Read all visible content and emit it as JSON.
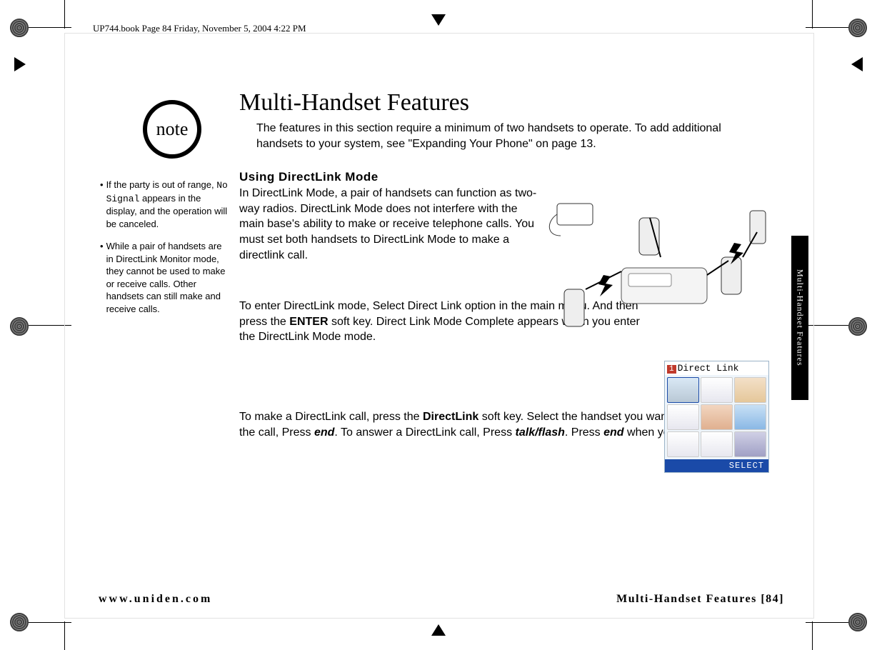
{
  "header": {
    "running_head": "UP744.book  Page 84  Friday, November 5, 2004  4:22 PM"
  },
  "side_tab": "Multi-Handset Features",
  "note": {
    "badge": "note",
    "items": [
      {
        "pre": "If the party is out of range, ",
        "mono": "No Signal",
        "post": " appears in the display, and the operation will be canceled."
      },
      {
        "text": "While a pair of handsets are in DirectLink Monitor mode, they cannot be used to make or receive calls. Other handsets can still make and receive calls."
      }
    ]
  },
  "main": {
    "title": "Multi-Handset Features",
    "intro": "The features in this section require a minimum of two handsets to operate. To add additional handsets to your system, see \"Expanding Your Phone\" on page 13.",
    "subhead": "Using DirectLink Mode",
    "p1": "In DirectLink Mode, a pair of handsets can function as two-way radios. DirectLink Mode does not interfere with the main base's ability to make or receive telephone calls. You must set both handsets to DirectLink Mode to make a directlink call.",
    "p2_a": "To enter DirectLink mode, Select Direct Link option in the main menu. And then press the ",
    "p2_enter": "ENTER",
    "p2_b": " soft key. Direct Link Mode Complete appears when you enter the DirectLink Mode mode.",
    "p3_a": "To make a DirectLink call, press the ",
    "p3_dl": "DirectLink",
    "p3_b": " soft key. Select the handset you want to call. To cancel the call, Press ",
    "p3_end": "end",
    "p3_c": ". To answer a DirectLink call, Press ",
    "p3_talk": "talk/flash",
    "p3_d": ". Press ",
    "p3_end2": "end",
    "p3_e": " when you want to hang up."
  },
  "lcd": {
    "num": "1",
    "title": "Direct Link",
    "select": "SELECT"
  },
  "footer": {
    "left": "www.uniden.com",
    "right": "Multi-Handset Features [84]"
  }
}
